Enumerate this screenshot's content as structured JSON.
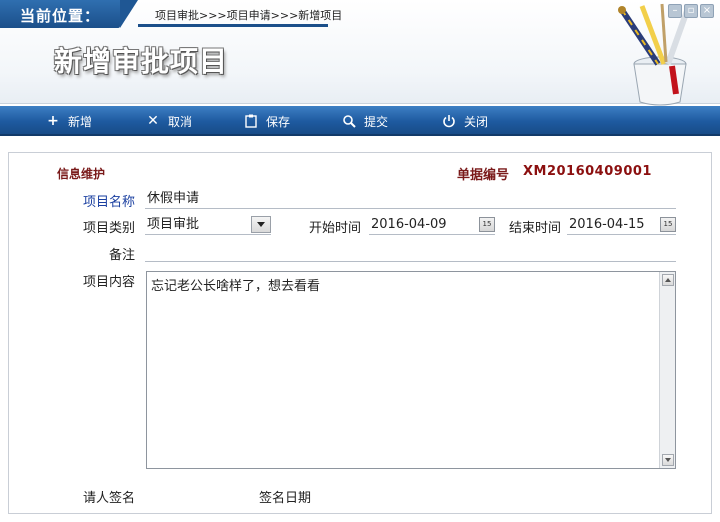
{
  "location": {
    "label": "当前位置：",
    "breadcrumb": "项目审批>>>项目申请>>>新增项目"
  },
  "page_title": "新增审批项目",
  "toolbar": {
    "add_label": "新增",
    "cancel_label": "取消",
    "save_label": "保存",
    "submit_label": "提交",
    "close_label": "关闭"
  },
  "form": {
    "section_title": "信息维护",
    "doc_no_label": "单据编号",
    "doc_no_value": "XM20160409001",
    "project_name_label": "项目名称",
    "project_name_value": "休假申请",
    "project_type_label": "项目类别",
    "project_type_value": "项目审批",
    "start_time_label": "开始时间",
    "start_time_value": "2016-04-09",
    "end_time_label": "结束时间",
    "end_time_value": "2016-04-15",
    "remark_label": "备注",
    "remark_value": "",
    "content_label": "项目内容",
    "content_value": "忘记老公长啥样了，想去看看",
    "applicant_sign_label": "请人签名",
    "sign_date_label": "签名日期",
    "date_btn_text": "15"
  }
}
